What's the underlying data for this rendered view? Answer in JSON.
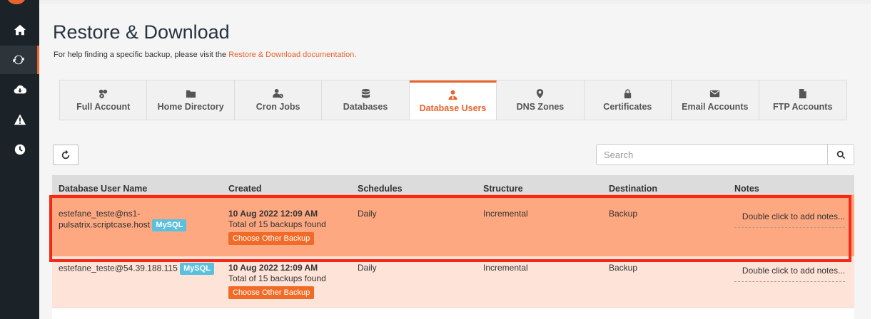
{
  "page": {
    "title": "Restore & Download",
    "help_text": "For help finding a specific backup, please visit the ",
    "help_link": "Restore & Download documentation."
  },
  "sidebar": {
    "items": [
      {
        "icon": "home-icon"
      },
      {
        "icon": "refresh-icon",
        "active": true
      },
      {
        "icon": "cloud-download-icon"
      },
      {
        "icon": "warning-icon"
      },
      {
        "icon": "clock-icon"
      }
    ]
  },
  "tabs": [
    {
      "label": "Full Account",
      "icon": "users-cog-icon"
    },
    {
      "label": "Home Directory",
      "icon": "folder-icon"
    },
    {
      "label": "Cron Jobs",
      "icon": "user-clock-icon"
    },
    {
      "label": "Databases",
      "icon": "database-icon"
    },
    {
      "label": "Database Users",
      "icon": "user-tie-icon",
      "active": true
    },
    {
      "label": "DNS Zones",
      "icon": "map-marker-icon"
    },
    {
      "label": "Certificates",
      "icon": "lock-icon"
    },
    {
      "label": "Email Accounts",
      "icon": "envelope-icon"
    },
    {
      "label": "FTP Accounts",
      "icon": "file-icon"
    }
  ],
  "search": {
    "placeholder": "Search"
  },
  "table": {
    "columns": [
      "Database User Name",
      "Created",
      "Schedules",
      "Structure",
      "Destination",
      "Notes"
    ],
    "rows": [
      {
        "name_line1": "estefane_teste@ns1-",
        "name_line2": "pulsatrix.scriptcase.host",
        "badge": "MySQL",
        "created": "10 Aug 2022 12:09 AM",
        "backups_found": "Total of 15 backups found",
        "choose_label": "Choose Other Backup",
        "schedule": "Daily",
        "structure": "Incremental",
        "destination": "Backup",
        "notes": "Double click to add notes..."
      },
      {
        "name_line1": "estefane_teste@54.39.188.115",
        "badge": "MySQL",
        "created": "10 Aug 2022 12:09 AM",
        "backups_found": "Total of 15 backups found",
        "choose_label": "Choose Other Backup",
        "schedule": "Daily",
        "structure": "Incremental",
        "destination": "Backup",
        "notes": "Double click to add notes..."
      }
    ]
  },
  "colors": {
    "accent": "#e8642c",
    "selected_row": "#fda880",
    "row_bg": "#fde3d8",
    "highlight_border": "#f22a17",
    "badge": "#5bc0de",
    "sidebar": "#1b2228"
  }
}
